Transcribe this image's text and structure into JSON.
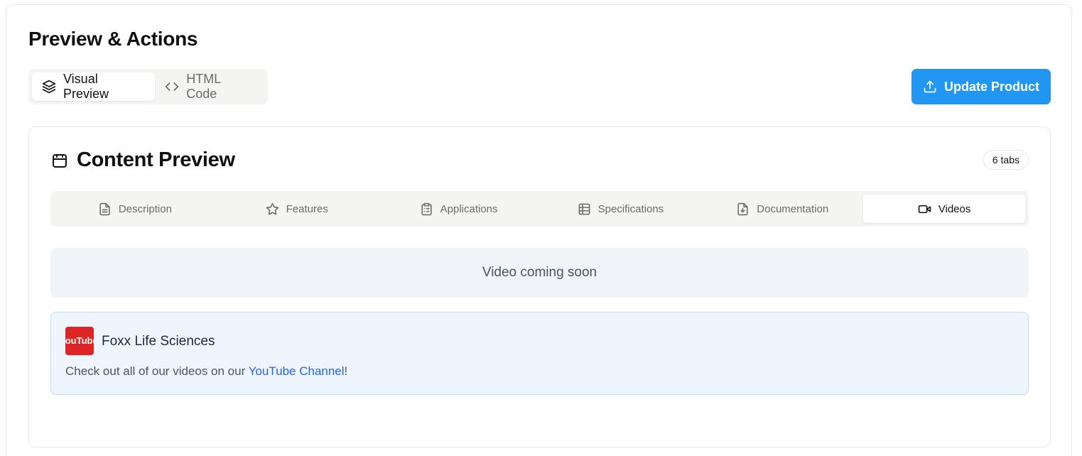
{
  "page": {
    "title": "Preview & Actions"
  },
  "mode_toggle": {
    "visual_label": "Visual Preview",
    "html_label": "HTML Code",
    "active": "visual"
  },
  "update_button": {
    "label": "Update Product",
    "icon": "upload-icon",
    "color": "#2196f3"
  },
  "content_preview": {
    "title": "Content Preview",
    "icon": "package-icon",
    "badge": "6 tabs",
    "tabs": [
      {
        "label": "Description",
        "icon": "file-text-icon"
      },
      {
        "label": "Features",
        "icon": "star-icon"
      },
      {
        "label": "Applications",
        "icon": "clipboard-list-icon"
      },
      {
        "label": "Specifications",
        "icon": "table-icon"
      },
      {
        "label": "Documentation",
        "icon": "file-download-icon"
      },
      {
        "label": "Videos",
        "icon": "video-icon"
      }
    ],
    "active_tab": "Videos"
  },
  "videos": {
    "placeholder": "Video coming soon",
    "channel": {
      "logo_text": "YouTube",
      "logo_color": "#dc2626",
      "name": "Foxx Life Sciences",
      "text_before": "Check out all of our videos on our ",
      "link_text": "YouTube Channel",
      "text_after": "!"
    }
  }
}
